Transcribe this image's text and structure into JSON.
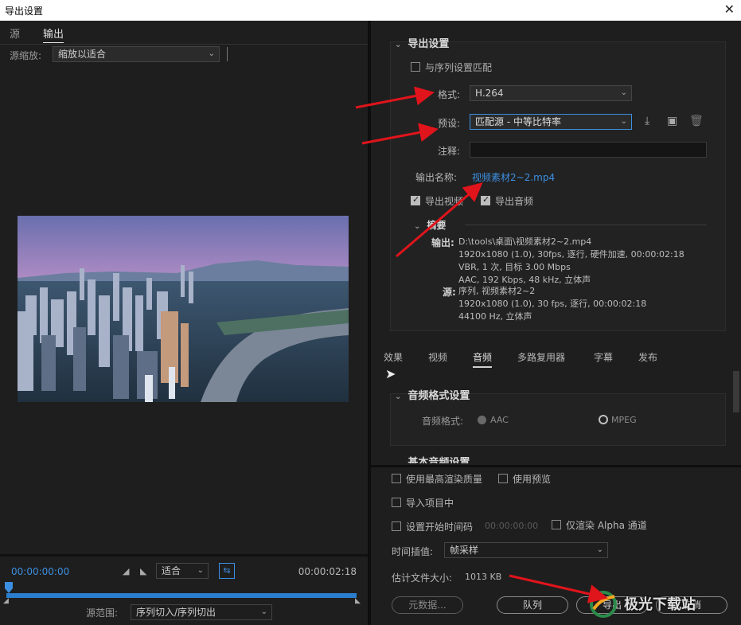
{
  "window": {
    "title": "导出设置"
  },
  "left": {
    "tabs": [
      {
        "label": "源"
      },
      {
        "label": "输出"
      }
    ],
    "source_zoom": {
      "label": "源缩放:",
      "value": "缩放以适合"
    },
    "timecode_start": "00:00:00:00",
    "timecode_end": "00:00:02:18",
    "fit_select": "适合",
    "source_range": {
      "label": "源范围:",
      "value": "序列切入/序列切出"
    }
  },
  "export": {
    "section_title": "导出设置",
    "match_sequence": "与序列设置匹配",
    "format_label": "格式:",
    "format_value": "H.264",
    "preset_label": "预设:",
    "preset_value": "匹配源 - 中等比特率",
    "comment_label": "注释:",
    "output_name_label": "输出名称:",
    "output_name_value": "视频素材2~2.mp4",
    "export_video": "导出视频",
    "export_audio": "导出音频",
    "summary_title": "摘要",
    "output_label": "输出:",
    "output_lines": [
      "D:\\tools\\桌面\\视频素材2~2.mp4",
      "1920x1080 (1.0), 30fps, 逐行, 硬件加速, 00:00:02:18",
      "VBR, 1 次, 目标 3.00 Mbps",
      "AAC, 192 Kbps, 48 kHz, 立体声"
    ],
    "source_label": "源:",
    "source_lines": [
      "序列, 视频素材2~2",
      "1920x1080 (1.0), 30 fps, 逐行, 00:00:02:18",
      "44100 Hz, 立体声"
    ]
  },
  "tabs_right": [
    {
      "label": "效果"
    },
    {
      "label": "视频"
    },
    {
      "label": "音频"
    },
    {
      "label": "多路复用器"
    },
    {
      "label": "字幕"
    },
    {
      "label": "发布"
    }
  ],
  "audio": {
    "section_title": "音频格式设置",
    "format_label": "音频格式:",
    "option_aac": "AAC",
    "option_mpeg": "MPEG",
    "next_section": "基本音频设置"
  },
  "bottom": {
    "max_quality": "使用最高渲染质量",
    "use_preview": "使用预览",
    "import_project": "导入项目中",
    "set_start_tc": "设置开始时间码",
    "start_tc_value": "00:00:00:00",
    "alpha_only": "仅渲染 Alpha 通道",
    "interp_label": "时间插值:",
    "interp_value": "帧采样",
    "file_size_label": "估计文件大小:",
    "file_size_value": "1013 KB",
    "metadata_btn": "元数据...",
    "queue_btn": "队列",
    "export_btn": "导出",
    "cancel_btn": "取消"
  },
  "watermark": {
    "text": "极光下载站"
  },
  "colors": {
    "accent": "#3c8fe0",
    "bg": "#1e1e1e",
    "arrow": "#e0141b"
  }
}
